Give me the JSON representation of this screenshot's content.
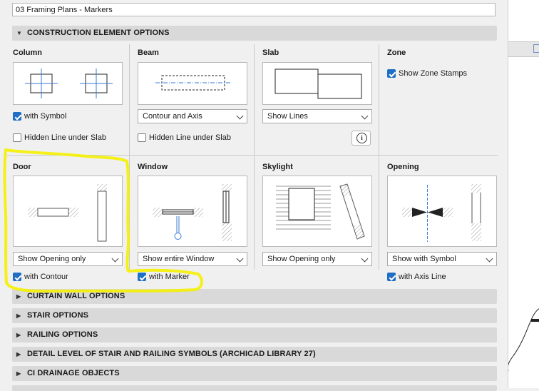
{
  "title_field": "03 Framing Plans - Markers",
  "construction": {
    "header": "CONSTRUCTION ELEMENT OPTIONS",
    "column": {
      "title": "Column",
      "with_symbol": "with Symbol",
      "hidden_line": "Hidden Line under Slab"
    },
    "beam": {
      "title": "Beam",
      "dropdown": "Contour and Axis",
      "hidden_line": "Hidden Line under Slab"
    },
    "slab": {
      "title": "Slab",
      "dropdown": "Show Lines"
    },
    "zone": {
      "title": "Zone",
      "show_stamps": "Show Zone Stamps"
    },
    "door": {
      "title": "Door",
      "dropdown": "Show Opening only",
      "with_contour": "with Contour"
    },
    "window": {
      "title": "Window",
      "dropdown": "Show entire Window",
      "with_marker": "with Marker"
    },
    "skylight": {
      "title": "Skylight",
      "dropdown": "Show Opening only"
    },
    "opening": {
      "title": "Opening",
      "dropdown": "Show with Symbol",
      "with_axis": "with Axis Line"
    }
  },
  "sections": [
    "CURTAIN WALL OPTIONS",
    "STAIR OPTIONS",
    "RAILING OPTIONS",
    "DETAIL LEVEL OF STAIR AND RAILING SYMBOLS (ARCHICAD LIBRARY 27)",
    "CI DRAINAGE OBJECTS"
  ],
  "colors": {
    "checkbox_checked": "#1f6fc4",
    "highlight": "#f4f000",
    "header_bg": "#d9d9d9"
  }
}
